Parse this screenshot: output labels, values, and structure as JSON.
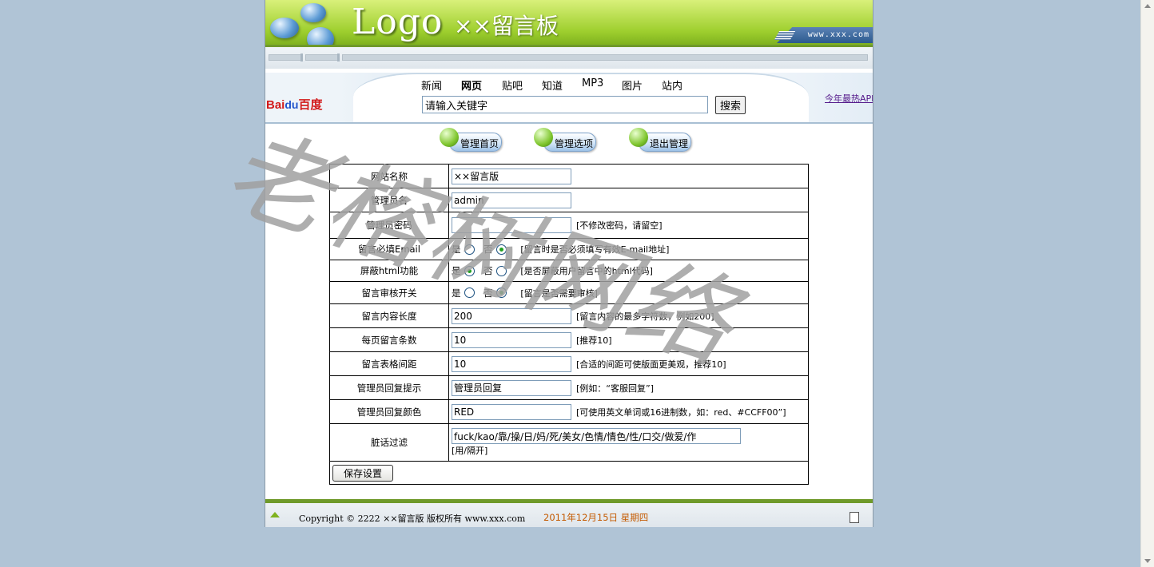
{
  "header": {
    "logo": "Logo",
    "site_title": "××留言板",
    "domain": "www.xxx.com"
  },
  "baidu": {
    "logo": "Bai",
    "logo_paw": "du",
    "logo_cn": "百度",
    "nav": [
      "新闻",
      "网页",
      "贴吧",
      "知道",
      "MP3",
      "图片",
      "站内"
    ],
    "active_nav": "网页",
    "search_value": "请输入关键字",
    "search_button": "搜索",
    "hot_link": "今年最热APP"
  },
  "menu": {
    "home": "管理首页",
    "options": "管理选项",
    "logout": "退出管理"
  },
  "settings": {
    "site_name": {
      "label": "网站名称",
      "value": "××留言版"
    },
    "admin_name": {
      "label": "管理员名",
      "value": "admin"
    },
    "admin_pwd": {
      "label": "管理员密码",
      "value": "",
      "hint": "[不修改密码，请留空]"
    },
    "email_required": {
      "label": "留言必填Email",
      "yes": "是",
      "no": "否",
      "selected": "no",
      "hint": "[留言时是否必须填写有效E-mail地址]"
    },
    "block_html": {
      "label": "屏蔽html功能",
      "yes": "是",
      "no": "否",
      "selected": "yes",
      "hint": "[是否屏蔽用户留言中的html代码]"
    },
    "review_switch": {
      "label": "留言审核开关",
      "yes": "是",
      "no": "否",
      "selected": "no",
      "hint": "[留言是否需要审核]"
    },
    "content_length": {
      "label": "留言内容长度",
      "value": "200",
      "hint": "[留言内容的最多字符数，例如200]"
    },
    "per_page": {
      "label": "每页留言条数",
      "value": "10",
      "hint": "[推荐10]"
    },
    "table_spacing": {
      "label": "留言表格间距",
      "value": "10",
      "hint": "[合适的间距可使版面更美观，推荐10]"
    },
    "reply_prompt": {
      "label": "管理员回复提示",
      "value": "管理员回复",
      "hint": "[例如：“客服回复”]"
    },
    "reply_color": {
      "label": "管理员回复颜色",
      "value": "RED",
      "hint": "[可使用英文单词或16进制数，如：red、#CCFF00”]"
    },
    "bad_words": {
      "label": "脏话过滤",
      "value": "fuck/kao/靠/操/日/妈/死/美女/色情/情色/性/口交/做爱/作",
      "hint": "[用/隔开]"
    },
    "save_button": "保存设置"
  },
  "footer": {
    "copyright": "Copyright © 2222 ××留言版 版权所有 www.xxx.com",
    "date": "2011年12月15日 星期四"
  },
  "watermark": "老榕树网络",
  "colors": {
    "header_green": "#9ecf2e",
    "footer_date": "#c45a00",
    "radio_dot": "#21a121"
  }
}
